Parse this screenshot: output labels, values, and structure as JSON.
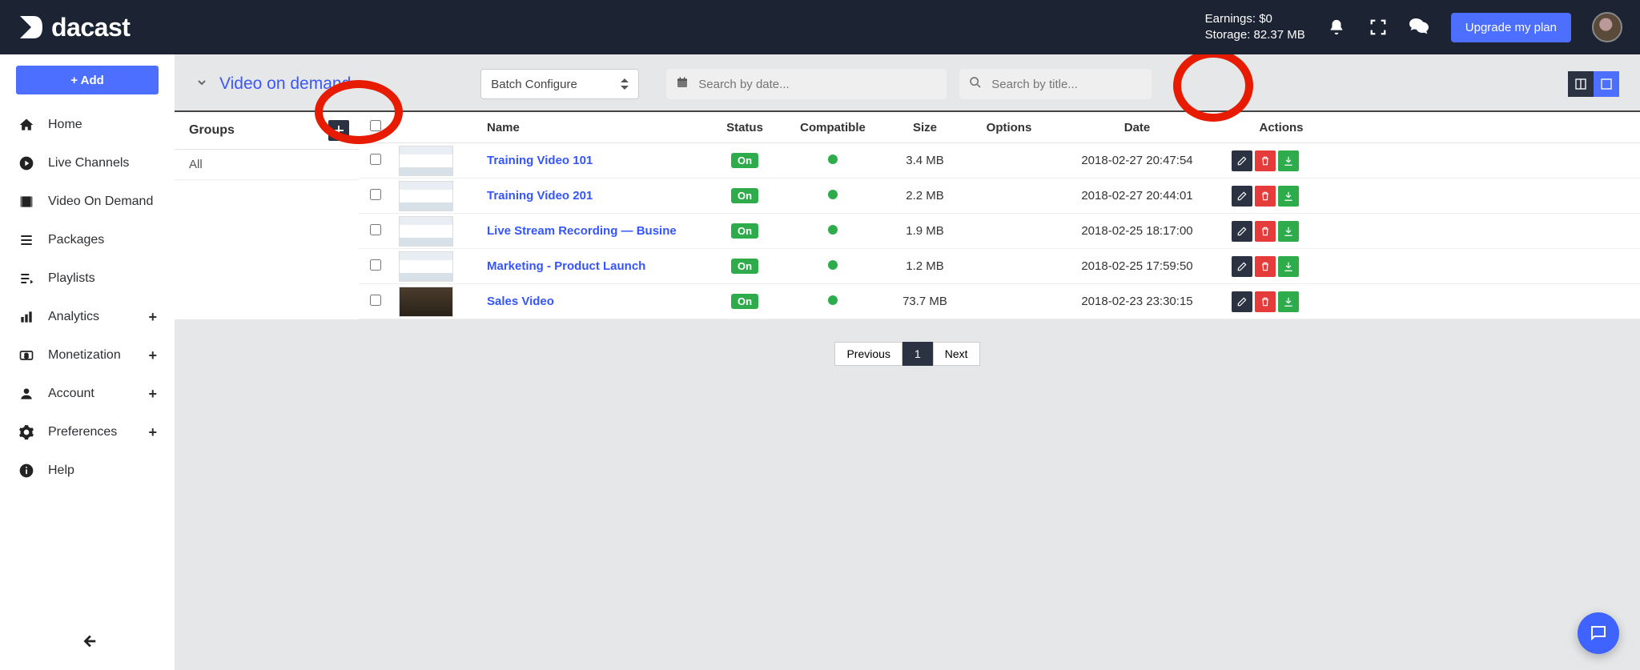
{
  "header": {
    "brand": "dacast",
    "earnings_label": "Earnings:",
    "earnings_value": "$0",
    "storage_label": "Storage:",
    "storage_value": "82.37 MB",
    "upgrade_label": "Upgrade my plan"
  },
  "sidebar": {
    "add_label": "+ Add",
    "items": [
      {
        "label": "Home",
        "icon": "home",
        "expandable": false
      },
      {
        "label": "Live Channels",
        "icon": "play-circle",
        "expandable": false
      },
      {
        "label": "Video On Demand",
        "icon": "film",
        "expandable": false
      },
      {
        "label": "Packages",
        "icon": "list",
        "expandable": false
      },
      {
        "label": "Playlists",
        "icon": "playlist",
        "expandable": false
      },
      {
        "label": "Analytics",
        "icon": "bar-chart",
        "expandable": true
      },
      {
        "label": "Monetization",
        "icon": "dollar",
        "expandable": true
      },
      {
        "label": "Account",
        "icon": "user",
        "expandable": true
      },
      {
        "label": "Preferences",
        "icon": "gear",
        "expandable": true
      },
      {
        "label": "Help",
        "icon": "info",
        "expandable": false
      }
    ]
  },
  "toolbar": {
    "title": "Video on demand",
    "batch_label": "Batch Configure",
    "search_date_placeholder": "Search by date...",
    "search_title_placeholder": "Search by title..."
  },
  "groups": {
    "header": "Groups",
    "items": [
      "All"
    ]
  },
  "table": {
    "columns": {
      "name": "Name",
      "status": "Status",
      "compatible": "Compatible",
      "size": "Size",
      "options": "Options",
      "date": "Date",
      "actions": "Actions"
    },
    "rows": [
      {
        "name": "Training Video 101",
        "status": "On",
        "size": "3.4 MB",
        "date": "2018-02-27 20:47:54",
        "thumb": "light"
      },
      {
        "name": "Training Video 201",
        "status": "On",
        "size": "2.2 MB",
        "date": "2018-02-27 20:44:01",
        "thumb": "light"
      },
      {
        "name": "Live Stream Recording — Busine",
        "status": "On",
        "size": "1.9 MB",
        "date": "2018-02-25 18:17:00",
        "thumb": "light"
      },
      {
        "name": "Marketing - Product Launch",
        "status": "On",
        "size": "1.2 MB",
        "date": "2018-02-25 17:59:50",
        "thumb": "light"
      },
      {
        "name": "Sales Video",
        "status": "On",
        "size": "73.7 MB",
        "date": "2018-02-23 23:30:15",
        "thumb": "dark"
      }
    ]
  },
  "pager": {
    "prev": "Previous",
    "next": "Next",
    "current": "1"
  }
}
